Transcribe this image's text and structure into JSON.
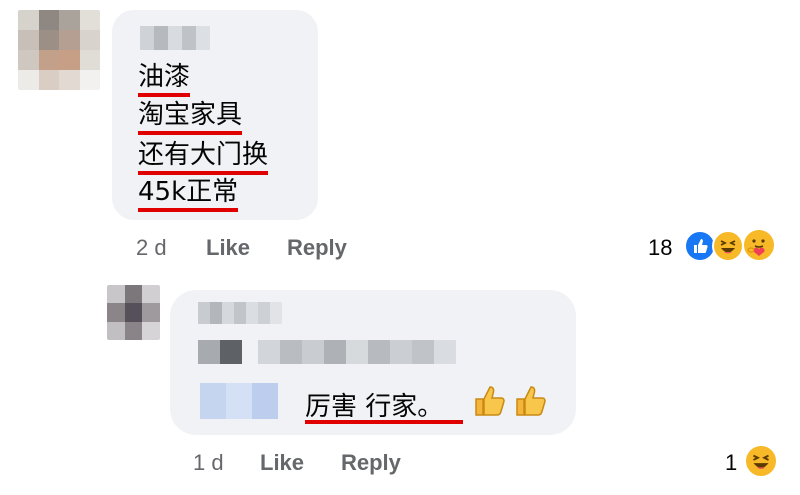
{
  "comment": {
    "lines": [
      "油漆",
      "淘宝家具",
      "还有大门换",
      "45k正常"
    ],
    "time": "2 d",
    "like_label": "Like",
    "reply_label": "Reply",
    "reaction_count": "18",
    "reactions": [
      "like-icon",
      "haha-icon",
      "care-icon"
    ]
  },
  "reply": {
    "text": "厉害 行家。",
    "emojis": [
      "thumbs-up-icon",
      "thumbs-up-icon"
    ],
    "time": "1 d",
    "like_label": "Like",
    "reply_label": "Reply",
    "reaction_count": "1",
    "reactions": [
      "haha-icon"
    ]
  },
  "colors": {
    "bubble": "#f0f2f5",
    "underline": "#e00000",
    "meta_text": "#65676b",
    "like_blue": "#1877f2",
    "emoji_yellow": "#f7b928"
  }
}
